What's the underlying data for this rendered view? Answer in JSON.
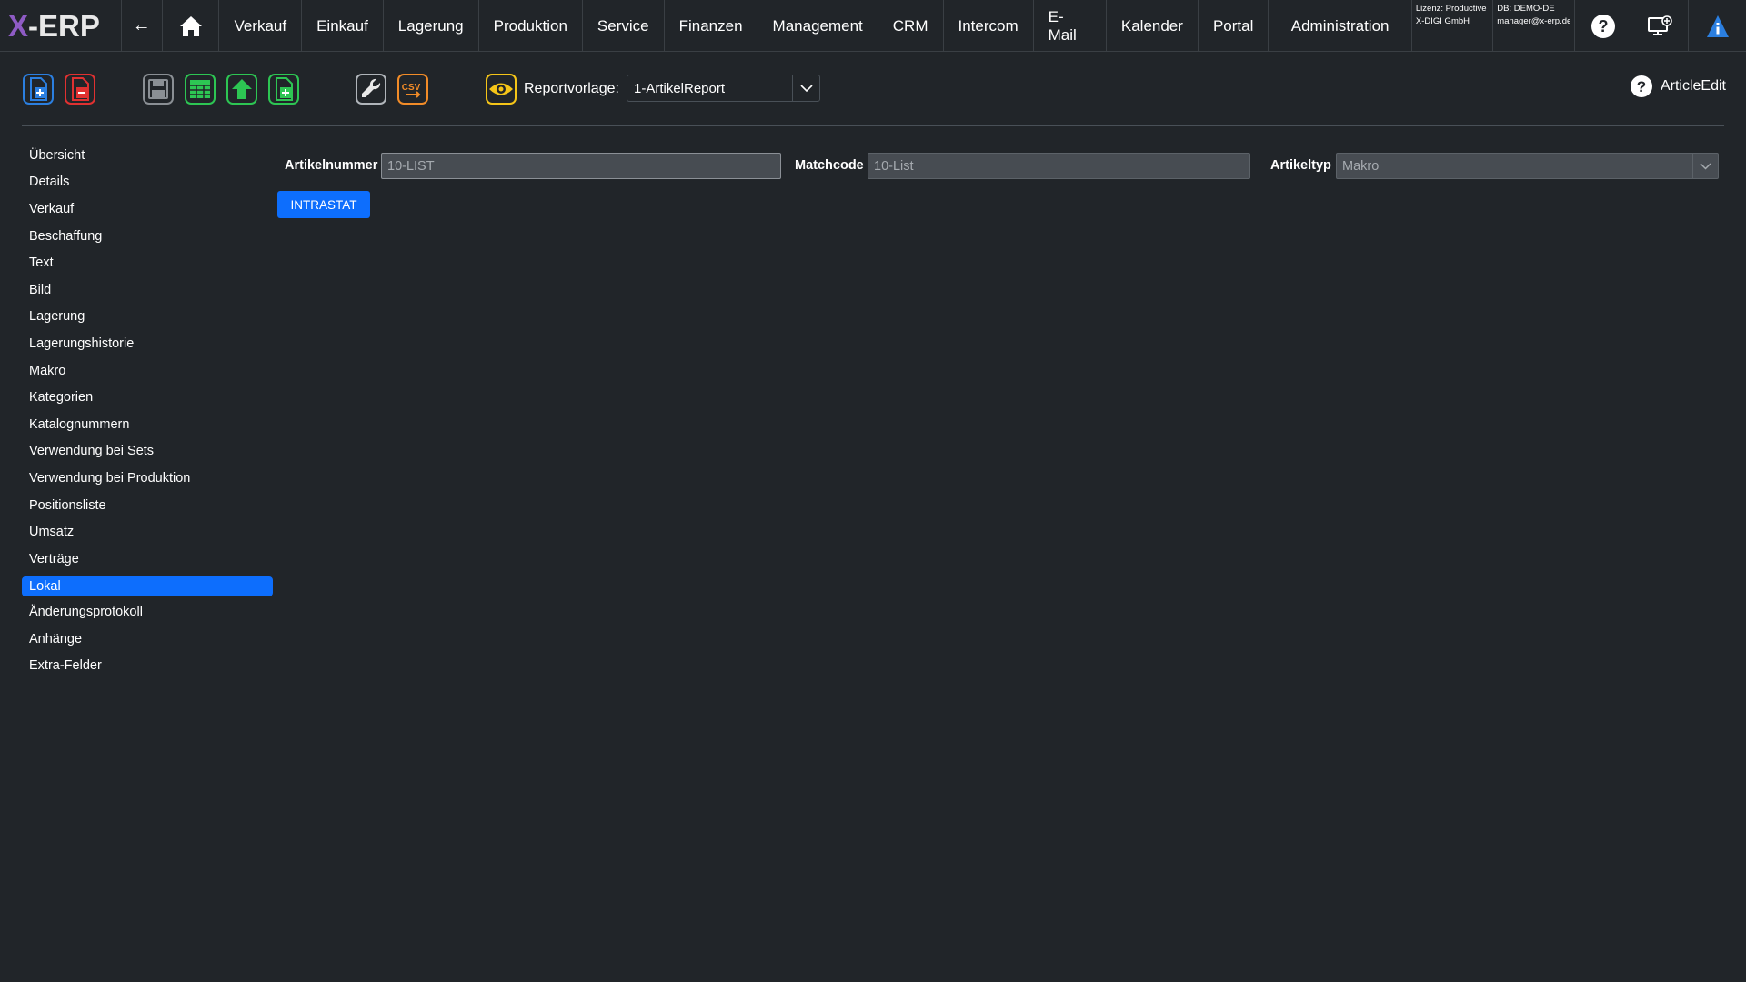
{
  "app": {
    "logo_x": "X",
    "logo_rest": "-ERP"
  },
  "nav": {
    "back_glyph": "←",
    "items": [
      "Verkauf",
      "Einkauf",
      "Lagerung",
      "Produktion",
      "Service",
      "Finanzen",
      "Management",
      "CRM",
      "Intercom",
      "E-Mail",
      "Kalender",
      "Portal",
      "Administration"
    ],
    "license_line1": "Lizenz: Productive",
    "license_line2": "X-DIGI GmbH",
    "db_line1": "DB: DEMO-DE",
    "db_line2": "manager@x-erp.de"
  },
  "toolbar": {
    "report_label": "Reportvorlage:",
    "report_value": "1-ArtikelReport",
    "help_label": "ArticleEdit",
    "csv_label": "CSV"
  },
  "sidebar": {
    "items": [
      "Übersicht",
      "Details",
      "Verkauf",
      "Beschaffung",
      "Text",
      "Bild",
      "Lagerung",
      "Lagerungshistorie",
      "Makro",
      "Kategorien",
      "Katalognummern",
      "Verwendung bei Sets",
      "Verwendung bei Produktion",
      "Positionsliste",
      "Umsatz",
      "Verträge",
      "Lokal",
      "Änderungsprotokoll",
      "Anhänge",
      "Extra-Felder"
    ],
    "active": "Lokal"
  },
  "form": {
    "artikelnummer_label": "Artikelnummer",
    "artikelnummer_value": "10-LIST",
    "matchcode_label": "Matchcode",
    "matchcode_value": "10-List",
    "artikeltyp_label": "Artikeltyp",
    "artikeltyp_value": "Makro",
    "intrastat_button": "INTRASTAT"
  },
  "colors": {
    "background": "#212529",
    "accent": "#0d6efd",
    "logo_accent": "#8e5bc4",
    "csv_orange": "#f28c28",
    "eye_yellow": "#f5c518",
    "add_green": "#2dc653",
    "delete_red": "#e03131"
  }
}
